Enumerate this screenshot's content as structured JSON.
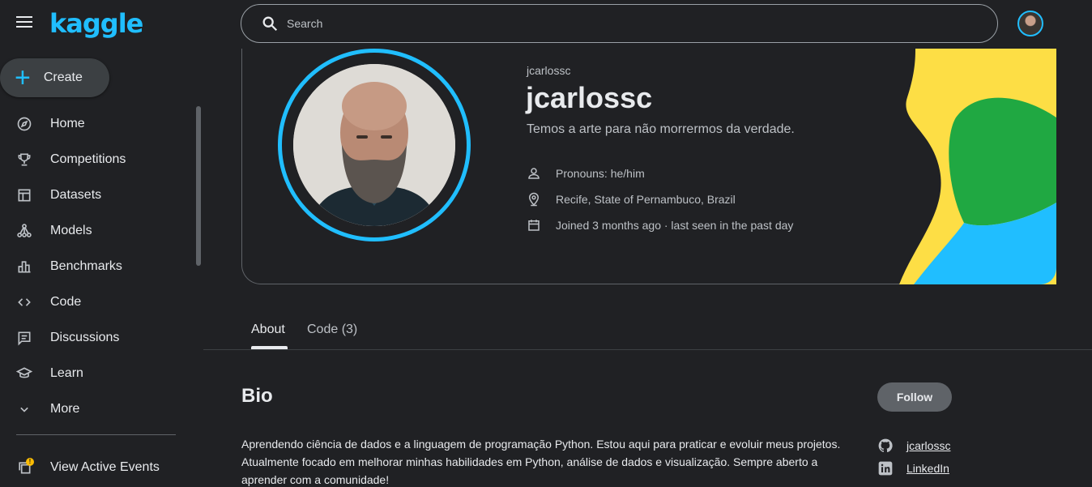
{
  "brand": {
    "logo_text": "kaggle",
    "accent_color": "#20beff"
  },
  "sidebar": {
    "create_label": "Create",
    "items": [
      {
        "label": "Home",
        "icon": "compass-icon"
      },
      {
        "label": "Competitions",
        "icon": "trophy-icon"
      },
      {
        "label": "Datasets",
        "icon": "table-icon"
      },
      {
        "label": "Models",
        "icon": "models-icon"
      },
      {
        "label": "Benchmarks",
        "icon": "bar-chart-icon"
      },
      {
        "label": "Code",
        "icon": "code-icon"
      },
      {
        "label": "Discussions",
        "icon": "discussion-icon"
      },
      {
        "label": "Learn",
        "icon": "graduation-cap-icon"
      },
      {
        "label": "More",
        "icon": "chevron-down-icon"
      }
    ],
    "events": {
      "label": "View Active Events",
      "badge": "!"
    }
  },
  "search": {
    "placeholder": "Search"
  },
  "profile": {
    "username_small": "jcarlossc",
    "username": "jcarlossc",
    "tagline": "Temos a arte para não morrermos da verdade.",
    "pronouns": "Pronouns: he/him",
    "location": "Recife, State of Pernambuco, Brazil",
    "joined": "Joined 3 months ago · last seen in the past day",
    "decor_colors": [
      "#fdde45",
      "#20a842",
      "#20beff"
    ]
  },
  "tabs": [
    {
      "label": "About",
      "active": true
    },
    {
      "label": "Code (3)",
      "active": false
    }
  ],
  "bio": {
    "title": "Bio",
    "text": "Aprendendo ciência de dados e a linguagem de programação Python. Estou aqui para praticar e evoluir meus projetos. Atualmente focado em melhorar minhas habilidades em Python, análise de dados e visualização. Sempre aberto a aprender com a comunidade!"
  },
  "follow_label": "Follow",
  "social_links": [
    {
      "label": "jcarlossc",
      "icon": "github-icon"
    },
    {
      "label": "LinkedIn",
      "icon": "linkedin-icon"
    }
  ]
}
